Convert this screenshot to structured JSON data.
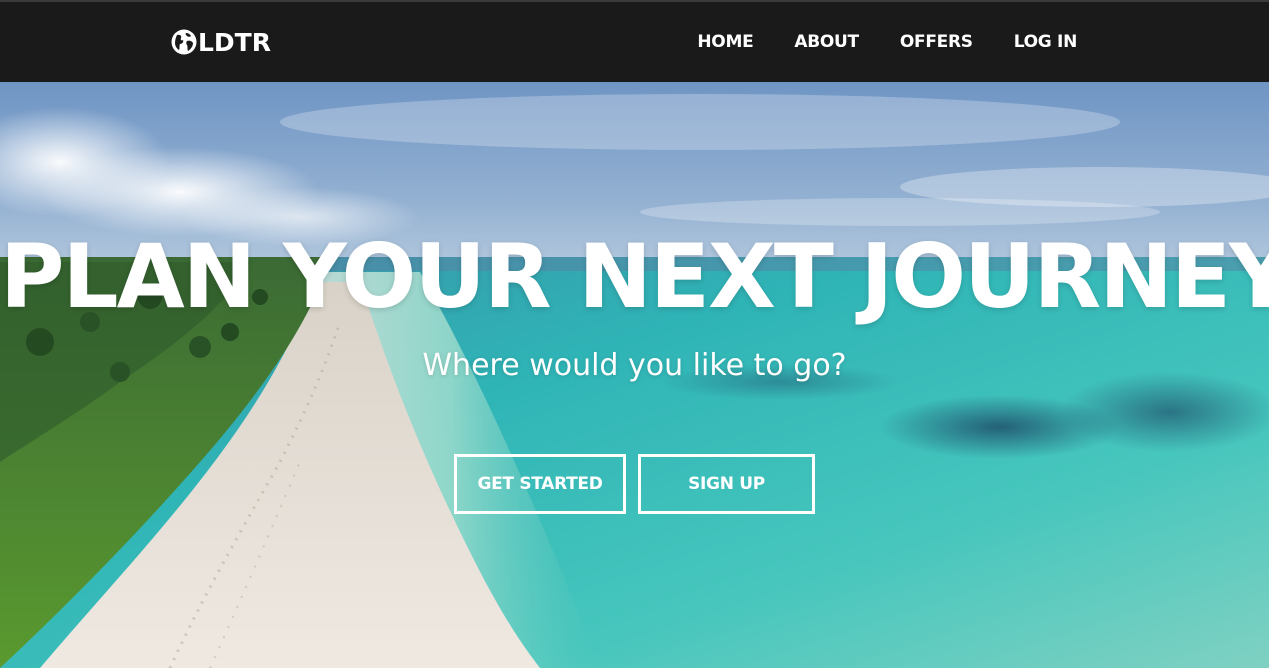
{
  "navbar": {
    "logo_text": "LDTR",
    "logo_icon": "globe-icon",
    "background": "#1b1a1a",
    "links": [
      {
        "label": "HOME"
      },
      {
        "label": "ABOUT"
      },
      {
        "label": "OFFERS"
      },
      {
        "label": "LOG IN"
      }
    ]
  },
  "hero": {
    "background_image": "aerial beach and turquoise ocean",
    "title": "PLAN YOUR NEXT JOURNEY",
    "subtitle": "Where would you like to go?",
    "buttons": [
      {
        "label": "GET STARTED"
      },
      {
        "label": "SIGN UP"
      }
    ]
  },
  "colors": {
    "text": "#ffffff",
    "navbar": "#1b1a1a",
    "ocean": "#3fc2bb",
    "sand": "#e8dfd6",
    "vegetation": "#4e8a2e"
  }
}
